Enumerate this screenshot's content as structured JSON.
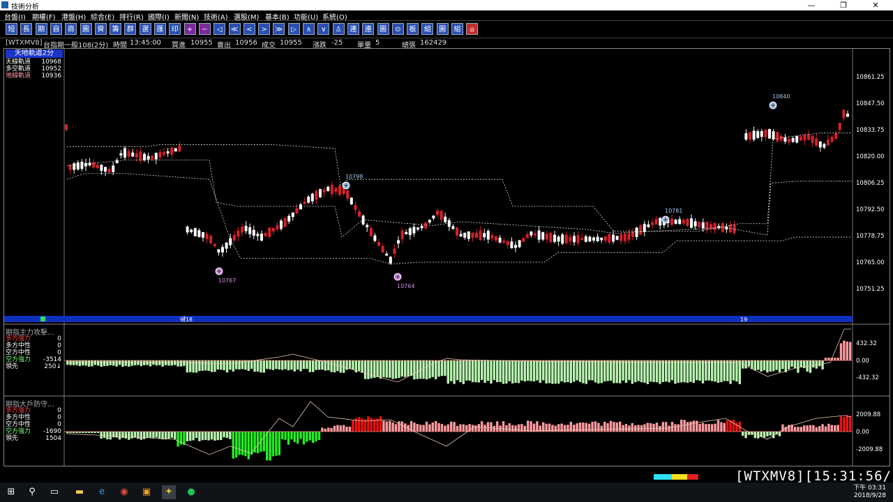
{
  "window": {
    "title": "技術分析",
    "controls": [
      "—",
      "❐",
      "✕"
    ]
  },
  "menu": [
    "台盤(I)",
    "期權(F)",
    "港盤(H)",
    "綜合(E)",
    "排行(R)",
    "國際(I)",
    "新聞(N)",
    "技術(A)",
    "選股(M)",
    "基本(B)",
    "功能(U)",
    "系統(O)"
  ],
  "toolbar": [
    "短",
    "長",
    "期",
    "自",
    "商",
    "圖",
    "資",
    "籌",
    "群",
    "選",
    "匯",
    "印",
    "+",
    "−",
    "◁",
    "≪",
    "<",
    ">",
    "≫",
    "▷",
    "∧",
    "∨",
    "♙",
    "連",
    "連",
    "圖",
    "⊙",
    "板",
    "組",
    "圖",
    "組",
    "⌂"
  ],
  "info": {
    "symbol": "[WTXMV8]",
    "name": "台指期一般108(2分)",
    "time_label": "時間",
    "time": "13:45:00",
    "bid_label": "買進",
    "bid": "10955",
    "ask_label": "賣出",
    "ask": "10956",
    "trade_label": "成交",
    "trade": "10955",
    "change_label": "漲跌",
    "change": "-25",
    "vol_label": "單量",
    "vol": "5",
    "total_label": "總張",
    "total": "162429"
  },
  "price_panel": {
    "indicator": "天地軌道2分",
    "rows": [
      {
        "label": "天線軌道",
        "value": "10968",
        "color": "#ffffff"
      },
      {
        "label": "多空軌道",
        "value": "10952",
        "color": "#ffffff"
      },
      {
        "label": "地線軌道",
        "value": "10936",
        "color": "#ff9aa8"
      }
    ],
    "y_ticks": [
      "10861.25",
      "10847.50",
      "10833.75",
      "10820.00",
      "10806.25",
      "10792.50",
      "10778.75",
      "10765.00",
      "10751.25"
    ],
    "markers": [
      {
        "label": "10767",
        "kind": "low"
      },
      {
        "label": "10798",
        "kind": "high"
      },
      {
        "label": "10764",
        "kind": "low"
      },
      {
        "label": "10781",
        "kind": "high"
      },
      {
        "label": "10840",
        "kind": "high"
      }
    ],
    "date_labels": [
      "9/18",
      "19"
    ]
  },
  "sub1": {
    "title": "期指主力攻擊…",
    "rows": [
      {
        "label": "多方強力",
        "value": "0",
        "color": "#ff4040"
      },
      {
        "label": "多方中性",
        "value": "0",
        "color": "#ffffff"
      },
      {
        "label": "空方中性",
        "value": "0",
        "color": "#ffffff"
      },
      {
        "label": "空方強力",
        "value": "-3514",
        "color": "#80ff80"
      },
      {
        "label": "領先",
        "value": "250↓",
        "color": "#ffffff"
      }
    ],
    "y_ticks": [
      "432.32",
      "0.00",
      "-432.32"
    ]
  },
  "sub2": {
    "title": "期指大戶防守…",
    "rows": [
      {
        "label": "多方強力",
        "value": "0",
        "color": "#ff4040"
      },
      {
        "label": "多方中性",
        "value": "0",
        "color": "#ffffff"
      },
      {
        "label": "空方中性",
        "value": "0",
        "color": "#ffffff"
      },
      {
        "label": "空方強力",
        "value": "-1690",
        "color": "#80ff80"
      },
      {
        "label": "領先",
        "value": "1504",
        "color": "#ffffff"
      }
    ],
    "y_ticks": [
      "2009.88",
      "0.00",
      "-2009.88"
    ]
  },
  "ticker": {
    "text": "[WTXMV8][15:31:56/"
  },
  "taskbar": {
    "time": "下午 03:31",
    "date": "2018/9/28"
  },
  "colors": {
    "up": "#d8202a",
    "down": "#ffffff",
    "bull_bar": "#ff9aa0",
    "bear_bar": "#b8f5b0",
    "strong_bear": "#22ee22",
    "strong_bull": "#ee1111"
  }
}
